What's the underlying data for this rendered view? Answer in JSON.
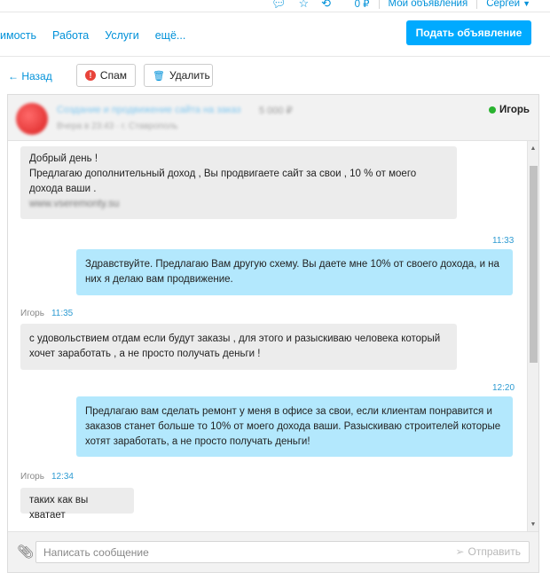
{
  "topbar": {
    "balance": "0 ₽",
    "my_ads": "Мои объявления",
    "user_name": "Сергей"
  },
  "nav": {
    "links": [
      "имость",
      "Работа",
      "Услуги",
      "ещё..."
    ],
    "post_button": "Подать объявление"
  },
  "actions": {
    "back": "← Назад",
    "spam": "Спам",
    "delete": "Удалить"
  },
  "chat": {
    "header": {
      "ad_title": "Создание и продвижение сайта на заказ",
      "ad_price": "5 000 ₽",
      "ad_meta": "Вчера в 23:43  ·  г. Ставрополь",
      "user": "Игорь"
    },
    "messages": [
      {
        "direction": "in",
        "lines": [
          "Добрый день !",
          "Предлагаю дополнительный доход , Вы продвигаете сайт за свои , 10 % от моего",
          "дохода ваши ."
        ],
        "link": "www.vseremonty.su"
      },
      {
        "direction": "out",
        "time": "11:33",
        "lines": [
          "Здравствуйте. Предлагаю Вам другую схему. Вы даете мне 10% от своего дохода, и на",
          "них я делаю вам продвижение."
        ]
      },
      {
        "direction": "in",
        "author": "Игорь",
        "time": "11:35",
        "lines": [
          "с удовольствием отдам если будут заказы , для этого и разыскиваю человека который",
          "хочет заработать , а не просто получать деньги !"
        ]
      },
      {
        "direction": "out",
        "time": "12:20",
        "lines": [
          "Предлагаю вам  сделать ремонт у меня в офисе за свои, если клиентам понравится и",
          "заказов станет больше то 10% от моего дохода ваши. Разыскиваю строителей которые",
          "хотят заработать, а не просто получать деньги!"
        ]
      },
      {
        "direction": "in",
        "author": "Игорь",
        "time": "12:34",
        "lines": [
          "таких как вы хватает"
        ]
      }
    ],
    "composer": {
      "placeholder": "Написать сообщение",
      "send": "Отправить"
    }
  },
  "colors": {
    "accent": "#00aaff",
    "link": "#0091d9",
    "outgoing_bubble": "#b3e8fd",
    "incoming_bubble": "#ececec",
    "online": "#2ab330"
  },
  "icons": [
    "chat-bubble-icon",
    "star-icon",
    "notification-icon",
    "chevron-down-icon",
    "spam-icon",
    "trash-icon",
    "online-dot-icon",
    "paperclip-icon",
    "send-icon"
  ]
}
